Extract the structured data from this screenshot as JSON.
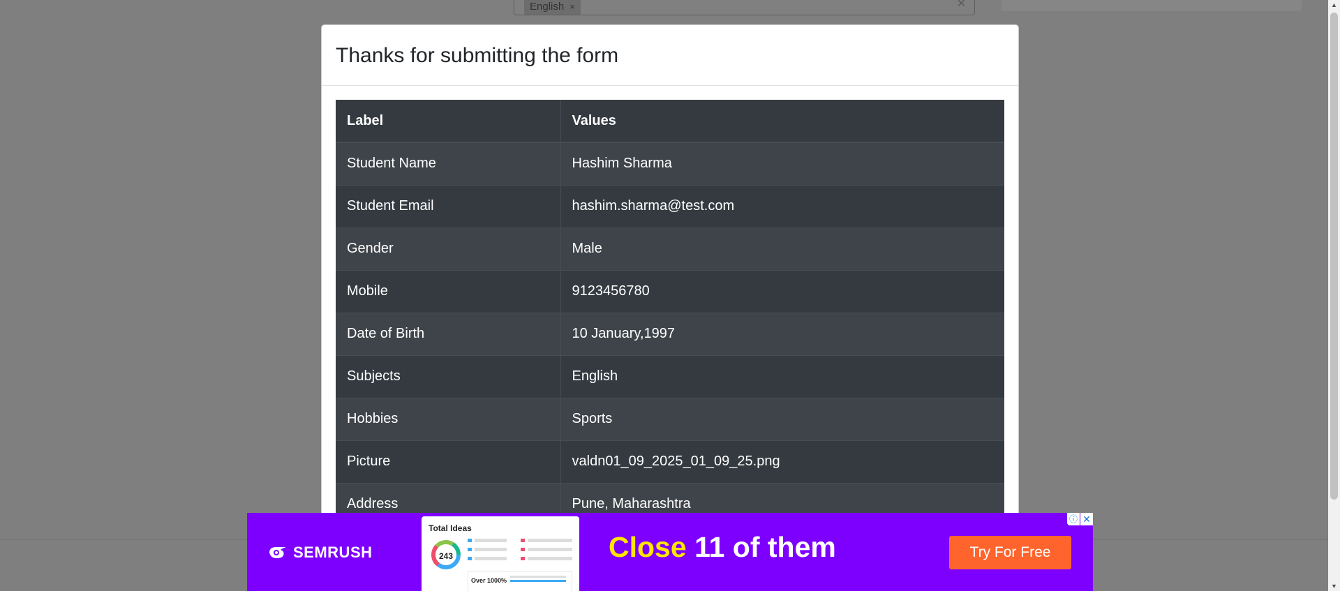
{
  "background": {
    "subjects_chip": "English",
    "chip_remove_glyph": "×",
    "clear_glyph": "✕"
  },
  "modal": {
    "title": "Thanks for submitting the form",
    "table": {
      "headers": [
        "Label",
        "Values"
      ],
      "rows": [
        {
          "label": "Student Name",
          "value": "Hashim Sharma"
        },
        {
          "label": "Student Email",
          "value": "hashim.sharma@test.com"
        },
        {
          "label": "Gender",
          "value": "Male"
        },
        {
          "label": "Mobile",
          "value": "9123456780"
        },
        {
          "label": "Date of Birth",
          "value": "10 January,1997"
        },
        {
          "label": "Subjects",
          "value": "English"
        },
        {
          "label": "Hobbies",
          "value": "Sports"
        },
        {
          "label": "Picture",
          "value": "valdn01_09_2025_01_09_25.png"
        },
        {
          "label": "Address",
          "value": "Pune, Maharashtra"
        }
      ]
    }
  },
  "ad": {
    "brand": "SEMRUSH",
    "screenshot_title": "Total Ideas",
    "screenshot_count": "243",
    "screenshot_over": "Over 1000%",
    "headline_accent": "Close",
    "headline_rest": "11 of them",
    "cta": "Try For Free",
    "info_glyph": "ⓘ",
    "close_glyph": "✕"
  },
  "colors": {
    "table_bg": "#343a40",
    "ad_bg": "#7d00ff",
    "ad_accent": "#ffe600",
    "cta_bg": "#ff642d"
  }
}
